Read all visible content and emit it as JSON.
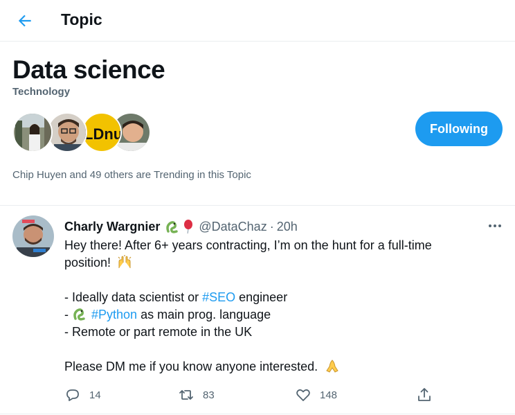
{
  "header": {
    "title": "Topic",
    "back_icon": "arrow-left-icon"
  },
  "topic": {
    "name": "Data science",
    "category": "Technology",
    "follow_label": "Following",
    "trending_text": "Chip Huyen and 49 others are Trending in this Topic"
  },
  "tweet": {
    "author_name": "Charly Wargnier",
    "name_emojis": [
      "snake-emoji",
      "balloon-emoji"
    ],
    "handle": "@DataChaz",
    "separator": "·",
    "time": "20h",
    "lines": {
      "l1": "Hey there! After 6+ years contracting, I’m on the hunt for a full-time",
      "l2": "position!",
      "l3_pre": "- Ideally data scientist or ",
      "l3_tag": "#SEO",
      "l3_post": " engineer",
      "l4_pre": "- ",
      "l4_tag": "#Python",
      "l4_post": " as main prog. language",
      "l5": "- Remote or part remote in the UK",
      "l6": "Please DM me if you know anyone interested."
    },
    "actions": {
      "replies": "14",
      "retweets": "83",
      "likes": "148"
    }
  },
  "colors": {
    "accent": "#1d9bf0",
    "text": "#0f1419",
    "muted": "#536471",
    "border": "#ebeef0"
  }
}
